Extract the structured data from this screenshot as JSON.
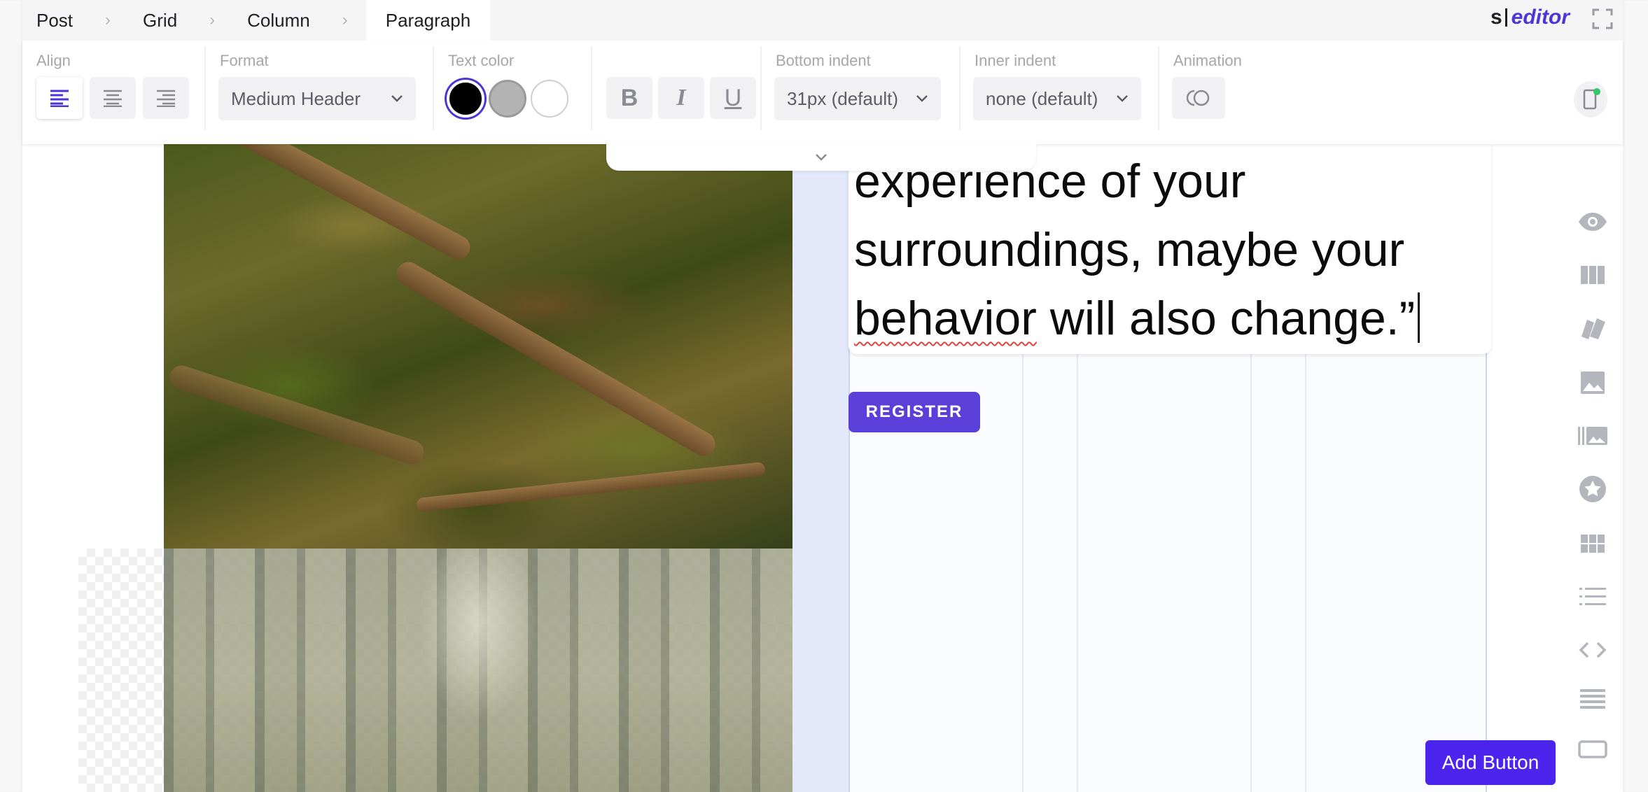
{
  "breadcrumb": {
    "items": [
      "Post",
      "Grid",
      "Column",
      "Paragraph"
    ],
    "separator": ">"
  },
  "brand": {
    "prefix": "s",
    "name": "editor"
  },
  "toolbar": {
    "align": {
      "label": "Align",
      "options": [
        "left-align-icon",
        "center-align-icon",
        "right-align-icon"
      ],
      "selected": "left"
    },
    "format": {
      "label": "Format",
      "value": "Medium Header"
    },
    "text_color": {
      "label": "Text color",
      "swatches": [
        "#000000",
        "#b3b3b3",
        "#ffffff"
      ],
      "selected": "#000000"
    },
    "style": {
      "bold": "B",
      "italic": "I",
      "underline": "U"
    },
    "bottom_indent": {
      "label": "Bottom indent",
      "value": "31px (default)"
    },
    "inner_indent": {
      "label": "Inner indent",
      "value": "none (default)"
    },
    "animation": {
      "label": "Animation"
    }
  },
  "content": {
    "quote_lines": [
      "experience of your",
      "surroundings, maybe your",
      "behavior will also change.”"
    ],
    "misspelled_word": "behavior",
    "register_label": "REGISTER",
    "add_button_label": "Add Button"
  },
  "rail": {
    "icons": [
      "eye-icon",
      "columns-icon",
      "cards-icon",
      "image-icon",
      "gallery-icon",
      "star-icon",
      "grid-icon",
      "list-icon",
      "code-icon",
      "rows-icon",
      "button-icon"
    ]
  },
  "colors": {
    "accent": "#4b24ee",
    "register": "#5b3fd9",
    "brand": "#4b35d6",
    "column_highlight": "#e3e9fb"
  }
}
